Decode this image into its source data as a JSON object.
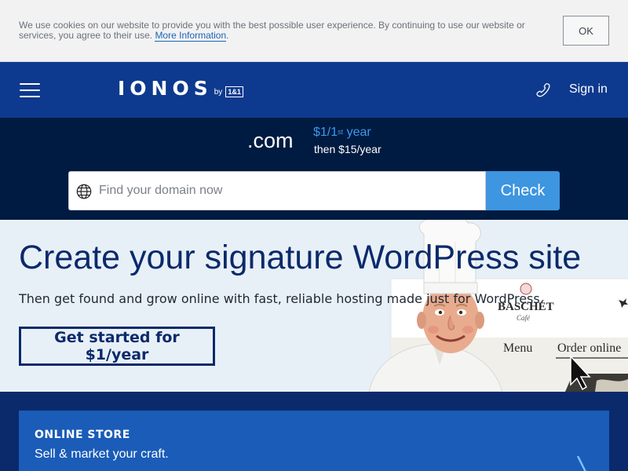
{
  "cookie": {
    "text": "We use cookies on our website to provide you with the best possible user experience. By continuing to use our website or services, you agree to their use.",
    "link_label": "More Information",
    "link_suffix": ".",
    "ok_label": "OK"
  },
  "header": {
    "menu_icon": "hamburger-icon",
    "logo_text": "IONOS",
    "logo_by": "by",
    "logo_brand": "1&1",
    "phone_icon": "phone-icon",
    "signin_label": "Sign in"
  },
  "domain": {
    "tld": ".com",
    "price_prefix": "$1/1",
    "price_sup": "st",
    "price_suffix": " year",
    "price_then": "then $15/year",
    "search_icon": "globe-icon",
    "search_placeholder": "Find your domain now",
    "search_value": "",
    "check_label": "Check"
  },
  "hero": {
    "title": "Create your signature WordPress site",
    "subtitle": "Then get found and grow online with fast, reliable hosting made just for WordPress.",
    "cta_label": "Get started for $1/year",
    "image": {
      "brand_text": "BASCHÉT",
      "brand_sub": "Café",
      "nav_menu": "Menu",
      "nav_order": "Order online"
    }
  },
  "card": {
    "eyebrow": "ONLINE STORE",
    "text": "Sell & market your craft.",
    "arrow_icon": "chevron-right-icon"
  },
  "colors": {
    "header_bg": "#0d3a8e",
    "domain_bg": "#001b41",
    "accent_blue": "#3e95e0",
    "hero_bg": "#e8f0f7",
    "brand_navy": "#0b2a6b",
    "card_bg": "#1a5cb8"
  }
}
